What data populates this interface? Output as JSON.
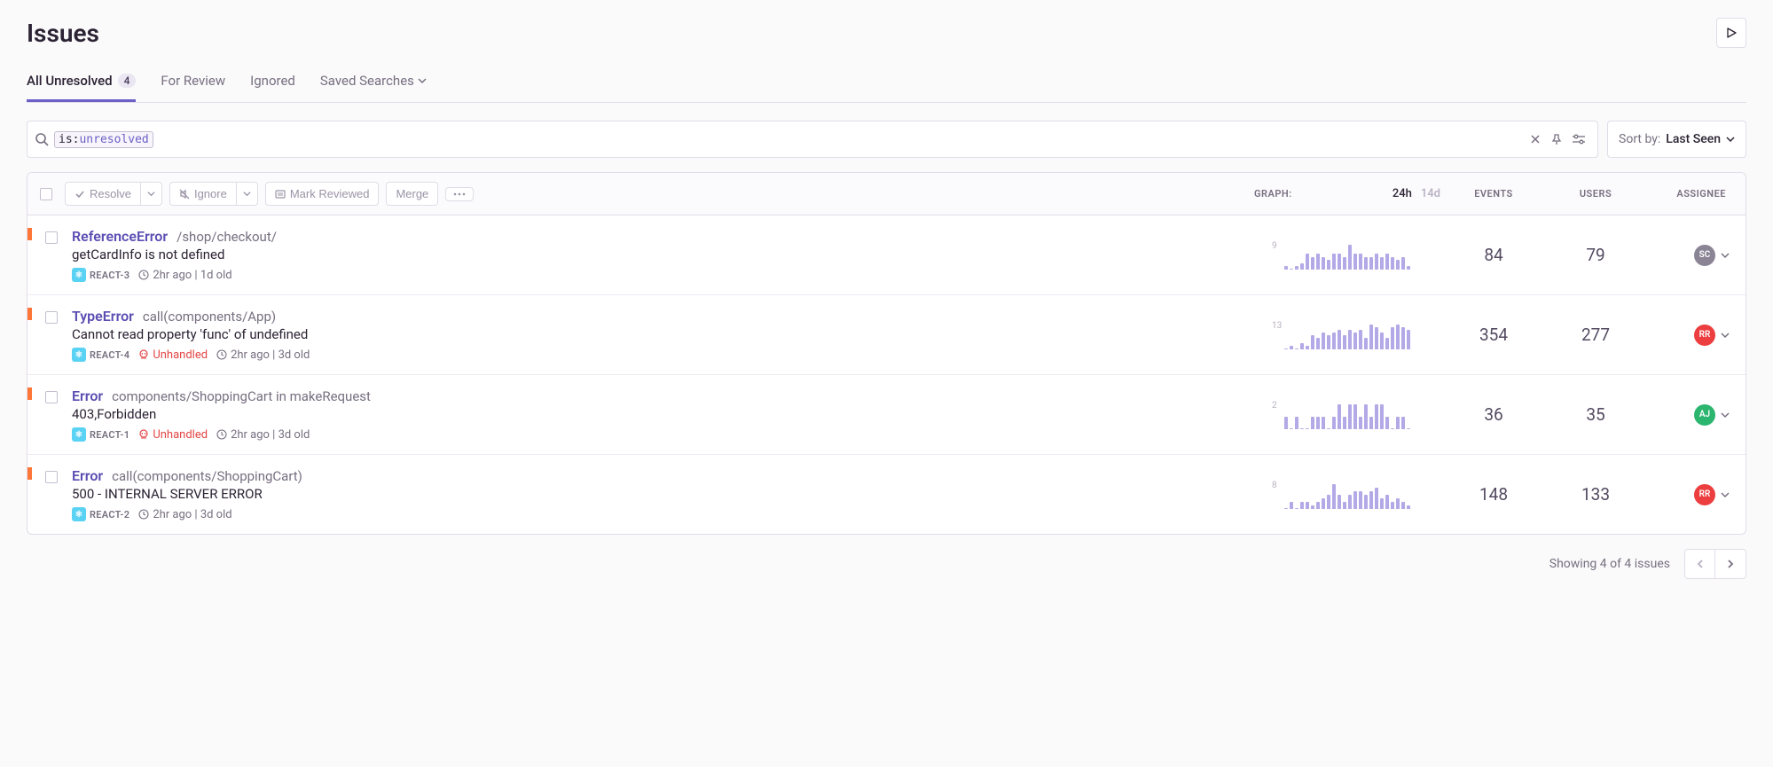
{
  "header": {
    "title": "Issues"
  },
  "tabs": {
    "all_unresolved": "All Unresolved",
    "all_unresolved_count": "4",
    "for_review": "For Review",
    "ignored": "Ignored",
    "saved_searches": "Saved Searches"
  },
  "search": {
    "token_key": "is:",
    "token_value": "unresolved"
  },
  "sort": {
    "label": "Sort by:",
    "value": "Last Seen"
  },
  "table_header": {
    "graph": "GRAPH:",
    "range_24h": "24h",
    "range_14d": "14d",
    "events": "EVENTS",
    "users": "USERS",
    "assignee": "ASSIGNEE"
  },
  "actions": {
    "resolve": "Resolve",
    "ignore": "Ignore",
    "mark_reviewed": "Mark Reviewed",
    "merge": "Merge"
  },
  "issues": [
    {
      "title": "ReferenceError",
      "location": "/shop/checkout/",
      "description": "getCardInfo is not defined",
      "tag": "REACT-3",
      "unhandled": "",
      "time": "2hr ago | 1d old",
      "spark_max": "9",
      "spark": [
        1,
        0,
        1,
        2,
        5,
        4,
        5,
        4,
        3,
        5,
        5,
        4,
        8,
        5,
        5,
        4,
        4,
        5,
        4,
        5,
        4,
        3,
        4,
        1
      ],
      "events": "84",
      "users": "79",
      "assignee_initials": "SC",
      "assignee_class": "av-sc"
    },
    {
      "title": "TypeError",
      "location": "call(components/App)",
      "description": "Cannot read property 'func' of undefined",
      "tag": "REACT-4",
      "unhandled": "Unhandled",
      "time": "2hr ago | 3d old",
      "spark_max": "13",
      "spark": [
        0,
        1,
        0,
        2,
        1,
        5,
        4,
        6,
        5,
        6,
        7,
        5,
        7,
        6,
        7,
        4,
        9,
        8,
        6,
        4,
        8,
        9,
        8,
        7
      ],
      "events": "354",
      "users": "277",
      "assignee_initials": "RR",
      "assignee_class": "av-rr"
    },
    {
      "title": "Error",
      "location": "components/ShoppingCart in makeRequest",
      "description": "403,Forbidden",
      "tag": "REACT-1",
      "unhandled": "Unhandled",
      "time": "2hr ago | 3d old",
      "spark_max": "2",
      "spark": [
        1,
        0,
        1,
        0,
        0,
        1,
        1,
        1,
        0,
        1,
        2,
        1,
        2,
        2,
        1,
        2,
        1,
        2,
        2,
        1,
        0,
        1,
        1,
        0
      ],
      "events": "36",
      "users": "35",
      "assignee_initials": "AJ",
      "assignee_class": "av-aj"
    },
    {
      "title": "Error",
      "location": "call(components/ShoppingCart)",
      "description": "500 - INTERNAL SERVER ERROR",
      "tag": "REACT-2",
      "unhandled": "",
      "time": "2hr ago | 3d old",
      "spark_max": "8",
      "spark": [
        0,
        2,
        0,
        2,
        2,
        1,
        2,
        3,
        4,
        7,
        4,
        2,
        4,
        5,
        5,
        4,
        5,
        6,
        3,
        4,
        2,
        3,
        2,
        1
      ],
      "events": "148",
      "users": "133",
      "assignee_initials": "RR",
      "assignee_class": "av-rr"
    }
  ],
  "footer": {
    "showing": "Showing 4 of 4 issues"
  }
}
